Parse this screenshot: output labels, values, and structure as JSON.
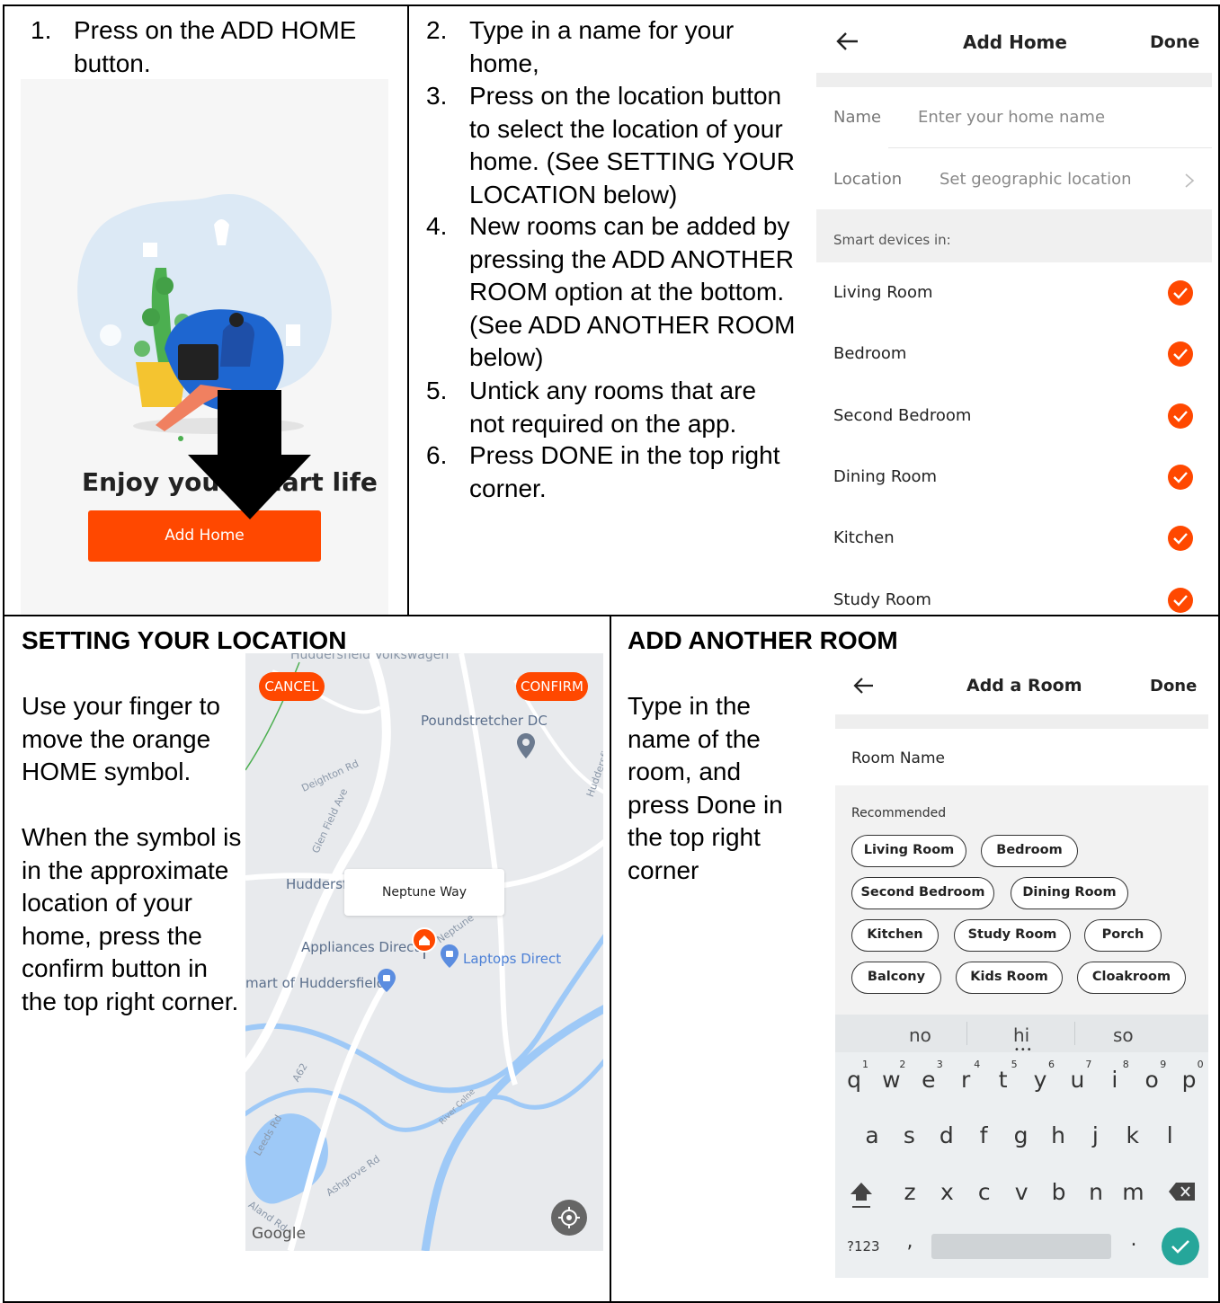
{
  "panel1": {
    "step_number": "1.",
    "step_text": "Press on the ADD HOME button.",
    "phone": {
      "headline": "Enjoy your smart life",
      "add_home_button": "Add Home"
    }
  },
  "panel2": {
    "steps": [
      {
        "n": "2.",
        "text": "Type in a name for your home,"
      },
      {
        "n": "3.",
        "text": "Press on the location button to select the location of your home.  (See SETTING YOUR LOCATION below)"
      },
      {
        "n": "4.",
        "text": "New rooms can be added by pressing the ADD ANOTHER ROOM option at the bottom. (See ADD ANOTHER ROOM below)"
      },
      {
        "n": "5.",
        "text": "Untick any rooms that are not required on the app."
      },
      {
        "n": "6.",
        "text": "Press DONE in the top right corner."
      }
    ],
    "phone": {
      "title": "Add Home",
      "done": "Done",
      "name_label": "Name",
      "name_placeholder": "Enter your home name",
      "location_label": "Location",
      "location_value": "Set geographic location",
      "section_header": "Smart devices in:",
      "rooms": [
        "Living Room",
        "Bedroom",
        "Second Bedroom",
        "Dining Room",
        "Kitchen",
        "Study Room"
      ]
    }
  },
  "panel3": {
    "heading": "SETTING YOUR LOCATION",
    "para1": "Use your finger to move the orange HOME symbol.",
    "para2": "When the symbol is in the approximate location of your home, press the confirm button in the top right corner.",
    "map": {
      "cancel": "CANCEL",
      "confirm": "CONFIRM",
      "top_label": "Huddersfield Volkswagen",
      "poundstretcher": "Poundstretcher DC",
      "deighton_rd": "Deighton Rd",
      "glen_field": "Glen Field Ave",
      "huddersfield": "Huddersf",
      "bubble": "Neptune Way",
      "neptune_road": "Neptune",
      "appliances": "Appliances Direct",
      "laptops": "Laptops Direct",
      "smart": "mart of Huddersfield",
      "a62": "A62",
      "leeds_rd": "Leeds Rd",
      "ashgrove_rd": "Ashgrove Rd",
      "river_colne": "River Colne",
      "huddersfield_rd": "Huddersfield",
      "aland_rd": "Aland Rd",
      "google": "Google"
    }
  },
  "panel4": {
    "heading": "ADD ANOTHER ROOM",
    "instructions": "Type in the name of the room, and press Done in the top right corner",
    "phone": {
      "title": "Add a Room",
      "done": "Done",
      "room_name_label": "Room Name",
      "recommended": "Recommended",
      "chips": [
        "Living Room",
        "Bedroom",
        "Second Bedroom",
        "Dining Room",
        "Kitchen",
        "Study Room",
        "Porch",
        "Balcony",
        "Kids Room",
        "Cloakroom"
      ],
      "suggestions": [
        "no",
        "hi",
        "so"
      ],
      "row1": [
        "q",
        "w",
        "e",
        "r",
        "t",
        "y",
        "u",
        "i",
        "o",
        "p"
      ],
      "row1_nums": [
        "1",
        "2",
        "3",
        "4",
        "5",
        "6",
        "7",
        "8",
        "9",
        "0"
      ],
      "row2": [
        "a",
        "s",
        "d",
        "f",
        "g",
        "h",
        "j",
        "k",
        "l"
      ],
      "row3": [
        "z",
        "x",
        "c",
        "v",
        "b",
        "n",
        "m"
      ],
      "symbols_key": "?123",
      "comma": ",",
      "period": "."
    }
  },
  "colors": {
    "accent": "#ff4800",
    "enter": "#26a69a"
  }
}
